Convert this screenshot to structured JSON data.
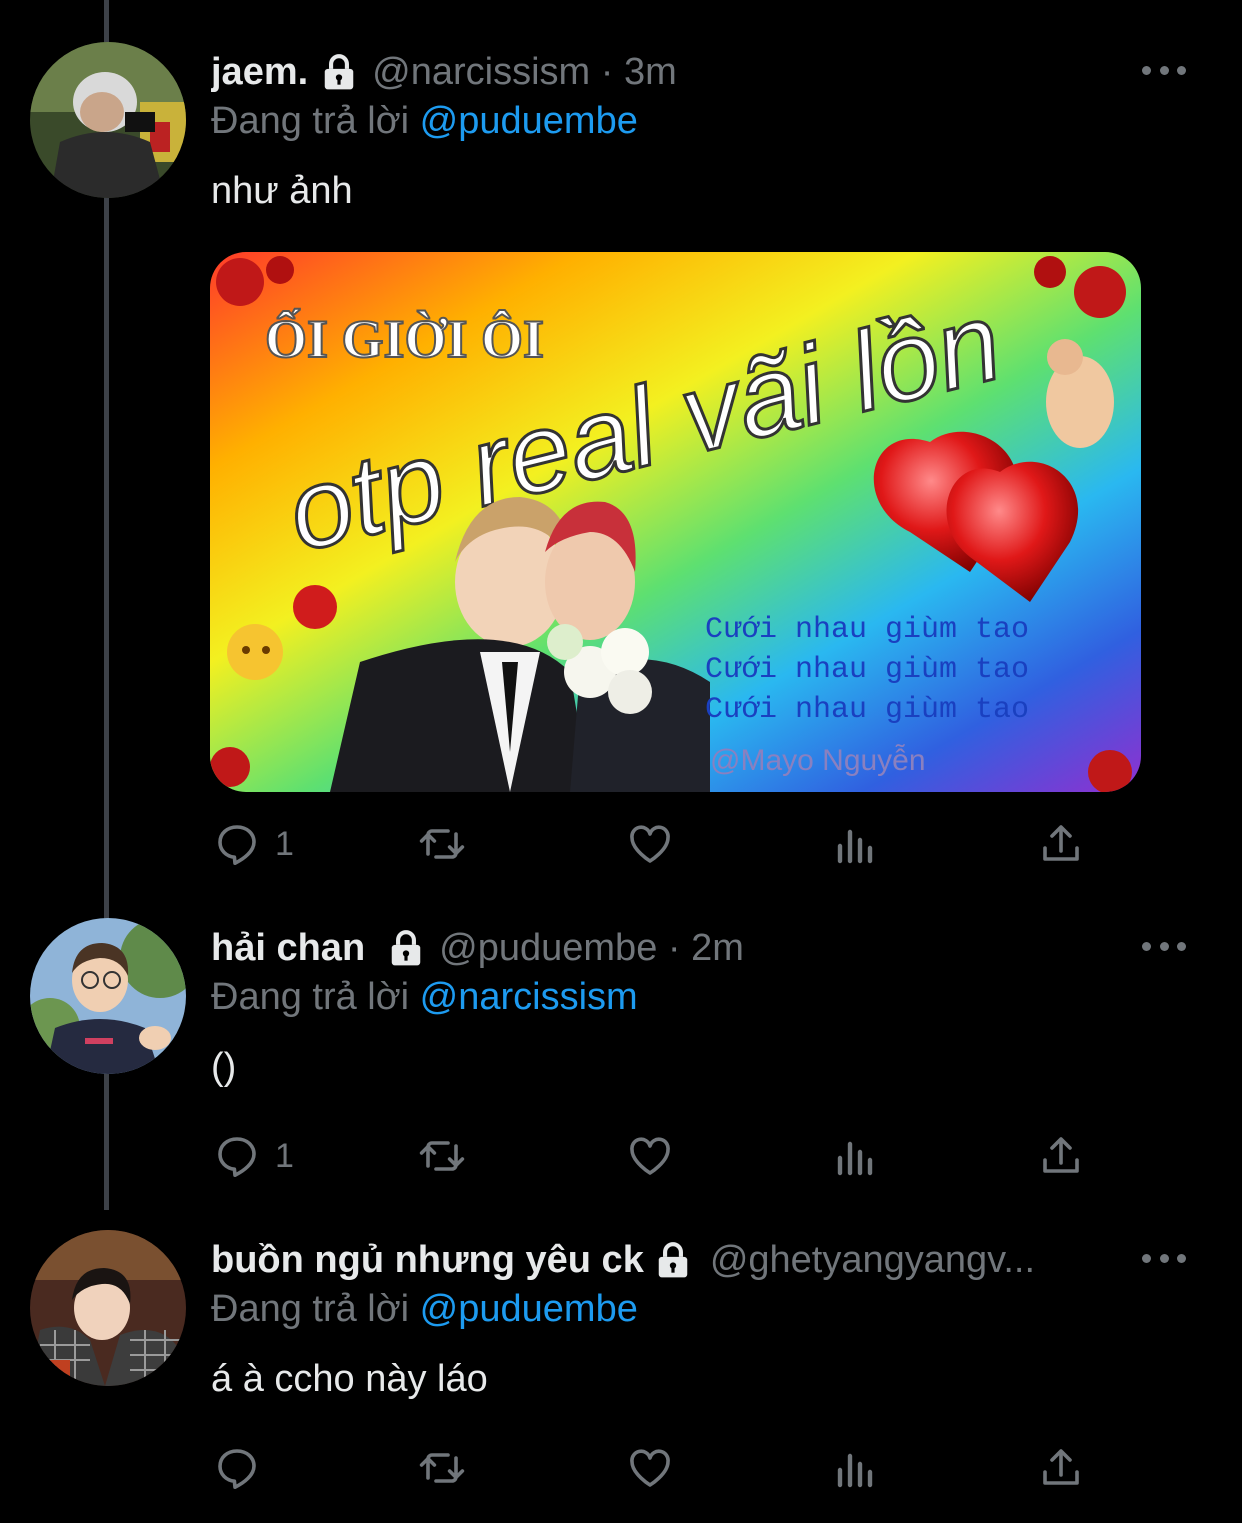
{
  "reply_prefix": "Đang trả lời",
  "colors": {
    "background": "#000000",
    "text": "#e7e9ea",
    "secondary": "#71767b",
    "link": "#1d9bf0",
    "thread_line": "#3d4148"
  },
  "tweets": [
    {
      "name": "jaem.",
      "handle_time": "@narcissism · 3m",
      "reply_to": "@puduembe",
      "text": "như ảnh",
      "reply_count": "1",
      "media": {
        "line1": "ỐI GIỜI ÔI",
        "line2": "otp real vãi lồn",
        "caption": [
          "Cưới nhau giùm tao",
          "Cưới nhau giùm tao",
          "Cưới nhau giùm tao"
        ],
        "credit": "@Mayo Nguyễn"
      }
    },
    {
      "name": "hải chan",
      "handle_time": "@puduembe · 2m",
      "reply_to": "@narcissism",
      "text": "()",
      "reply_count": "1"
    },
    {
      "name": "buồn ngủ nhưng yêu ck",
      "handle_time": "@ghetyangyangv...",
      "reply_to": "@puduembe",
      "text": "á à ccho này láo",
      "reply_count": ""
    }
  ],
  "icons": [
    "lock-icon",
    "more-icon",
    "reply-icon",
    "retweet-icon",
    "like-icon",
    "analytics-icon",
    "share-icon"
  ]
}
